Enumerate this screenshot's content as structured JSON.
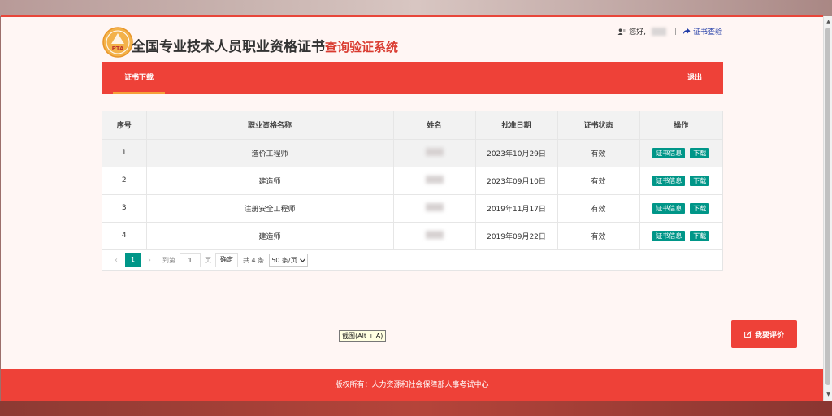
{
  "header": {
    "logo_text": "PTA",
    "title": "全国专业技术人员职业资格证书",
    "subtitle": "查询验证系统"
  },
  "userbar": {
    "greeting": "您好,",
    "separator": "|",
    "verify_label": "证书查验"
  },
  "nav": {
    "tab_label": "证书下载",
    "logout_label": "退出"
  },
  "table": {
    "columns": [
      "序号",
      "职业资格名称",
      "姓名",
      "批准日期",
      "证书状态",
      "操作"
    ],
    "rows": [
      {
        "index": "1",
        "name": "造价工程师",
        "date": "2023年10月29日",
        "status": "有效",
        "info_btn": "证书信息",
        "download_btn": "下载"
      },
      {
        "index": "2",
        "name": "建造师",
        "date": "2023年09月10日",
        "status": "有效",
        "info_btn": "证书信息",
        "download_btn": "下载"
      },
      {
        "index": "3",
        "name": "注册安全工程师",
        "date": "2019年11月17日",
        "status": "有效",
        "info_btn": "证书信息",
        "download_btn": "下载"
      },
      {
        "index": "4",
        "name": "建造师",
        "date": "2019年09月22日",
        "status": "有效",
        "info_btn": "证书信息",
        "download_btn": "下载"
      }
    ]
  },
  "pagination": {
    "current_page": "1",
    "goto_label": "到第",
    "page_input": "1",
    "page_unit": "页",
    "confirm_label": "确定",
    "total_label": "共 4 条",
    "page_size_label": "50 条/页"
  },
  "tooltip": "截图(Alt + A)",
  "rate_button": "我要评价",
  "footer": "版权所有：人力资源和社会保障部人事考试中心",
  "colors": {
    "brand_red": "#ee4138",
    "accent_orange": "#f6a13a",
    "button_green": "#009688",
    "title_red": "#d93a2f"
  }
}
